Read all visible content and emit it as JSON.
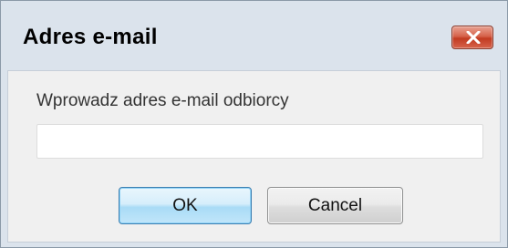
{
  "dialog": {
    "title": "Adres e-mail",
    "prompt": "Wprowadz adres e-mail odbiorcy",
    "email_value": "",
    "email_placeholder": "",
    "ok_label": "OK",
    "cancel_label": "Cancel",
    "close_icon": "close-icon"
  },
  "colors": {
    "close_button": "#c94a32",
    "ok_button_accent": "#3c7fb1"
  }
}
